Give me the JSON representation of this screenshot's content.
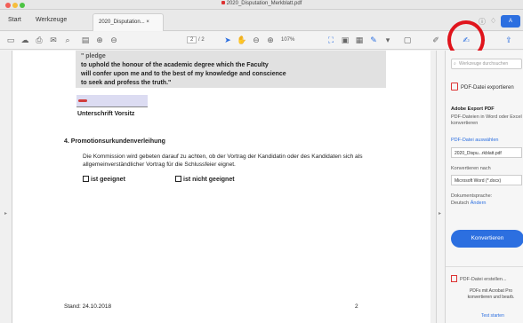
{
  "window": {
    "title": "2020_Disputation_Merkblatt.pdf"
  },
  "nav": {
    "start": "Start",
    "tools": "Werkzeuge"
  },
  "doc_tab": {
    "label": "2020_Disputation... ×"
  },
  "header_right": {
    "help": "?",
    "bell": "♫",
    "sign_in": "A"
  },
  "toolbar": {
    "page_current": "2",
    "page_total": "/ 2",
    "zoom": "107%"
  },
  "document": {
    "quote_line1": "\" pledge",
    "quote_line2": "to uphold the honour of the academic degree which the Faculty",
    "quote_line3": "will confer upon me and to the best of my knowledge and conscience",
    "quote_line4": "to seek and profess the truth.\"",
    "signature_label": "Unterschrift Vorsitz",
    "section_heading": "4.  Promotionsurkundenverleihung",
    "section_body": "Die Kommission wird gebeten darauf zu achten, ob der Vortrag der Kandidatin oder des Kandidaten sich als allgemeinverständlicher Vortrag für die Schlussfeier eignet.",
    "option1": "ist geeignet",
    "option2": "ist nicht geeignet",
    "footer_date": "Stand: 24.10.2018",
    "footer_page": "2"
  },
  "right_pane": {
    "search_placeholder": "Werkzeuge durchsuchen",
    "tool_export": "PDF-Datei exportieren",
    "export_heading": "Adobe Export PDF",
    "export_desc": "PDF-Dateien in Word oder Excel konvertieren",
    "select_file": "PDF-Datei auswählen",
    "selected_file": "2020_Dispu...rkblatt.pdf",
    "convert_to_label": "Konvertieren nach",
    "convert_to_value": "Microsoft Word (*.docx)",
    "doc_language_label": "Dokumentsprache:",
    "doc_language_value": "Deutsch",
    "change_link": "Ändern",
    "convert_button": "Konvertieren",
    "create_pdf": "PDF-Datei erstellen...",
    "promo_text": "PDFs mit Acrobat Pro konvertieren und bearb.",
    "trial_link": "Test starten"
  },
  "colors": {
    "accent": "#2c6fe0",
    "highlight_circle": "#e0141c"
  }
}
